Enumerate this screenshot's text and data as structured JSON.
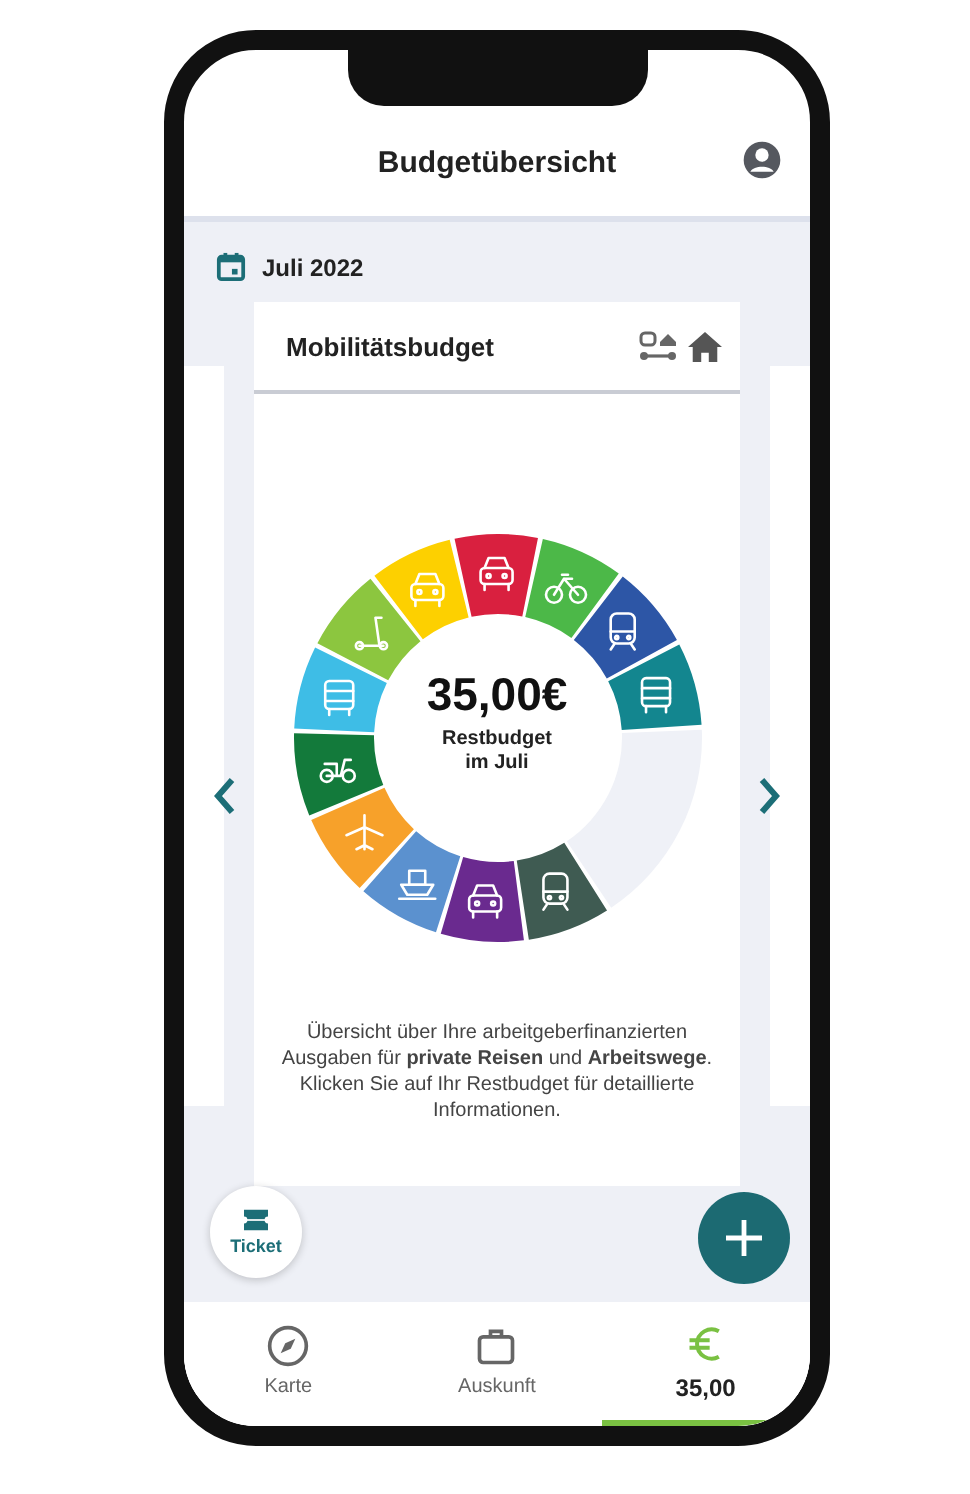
{
  "header": {
    "title": "Budgetübersicht"
  },
  "month": "Juli 2022",
  "card": {
    "title": "Mobilitätsbudget",
    "amount": "35,00€",
    "amount_label": "Restbudget im Juli",
    "segments": [
      {
        "color": "#d9203f"
      },
      {
        "color": "#4cb848"
      },
      {
        "color": "#2d56a6"
      },
      {
        "color": "#13868f"
      },
      {
        "color": "#3f5b52"
      },
      {
        "color": "#6a2a8f"
      },
      {
        "color": "#5b91cf"
      },
      {
        "color": "#f7a12a"
      },
      {
        "color": "#137a3b"
      },
      {
        "color": "#3ebde6"
      },
      {
        "color": "#8cc63f"
      },
      {
        "color": "#fdd000"
      }
    ],
    "description": "Übersicht über Ihre arbeitgeberfinanzierten Ausgaben für **private Reisen** und **Arbeitswege**. Klicken Sie auf Ihr Restbudget für detaillierte Informationen."
  },
  "ticket_button": {
    "label": "Ticket"
  },
  "nav": [
    {
      "kind": "map",
      "label": "Karte",
      "selected": false
    },
    {
      "kind": "info",
      "label": "Auskunft",
      "selected": false
    },
    {
      "kind": "budget",
      "label": "35,00",
      "selected": true
    }
  ]
}
